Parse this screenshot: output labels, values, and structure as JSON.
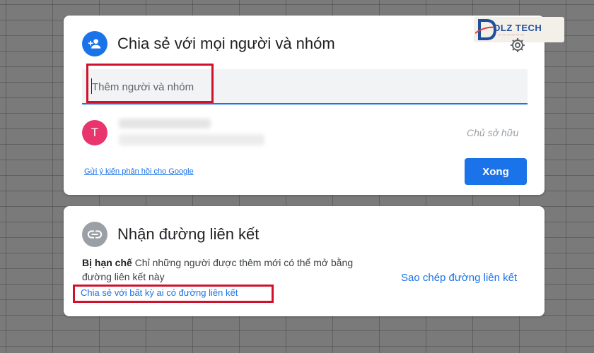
{
  "share_dialog": {
    "title": "Chia sẻ với mọi người và nhóm",
    "add_people_placeholder": "Thêm người và nhóm",
    "owner": {
      "avatar_letter": "T",
      "role": "Chủ sở hữu"
    },
    "feedback_link": "Gửi ý kiến phản hồi cho Google",
    "done_label": "Xong",
    "settings_icon": "gear-icon",
    "header_icon": "add-person-icon"
  },
  "link_dialog": {
    "title": "Nhận đường liên kết",
    "restriction_label": "Bị hạn chế",
    "restriction_description": "Chỉ những người được thêm mới có thể mở bằng đường liên kết này",
    "share_anyone_link": "Chia sẻ với bất kỳ ai có đường liên kết",
    "copy_link_label": "Sao chép đường liên kết",
    "header_icon": "link-icon"
  },
  "watermark": {
    "text": "DLZ TECH"
  },
  "colors": {
    "accent": "#1a73e8",
    "highlight": "#d0112b",
    "avatar": "#e8356d",
    "link_icon_bg": "#9aa0a6",
    "backdrop": "#7a7a7a"
  }
}
